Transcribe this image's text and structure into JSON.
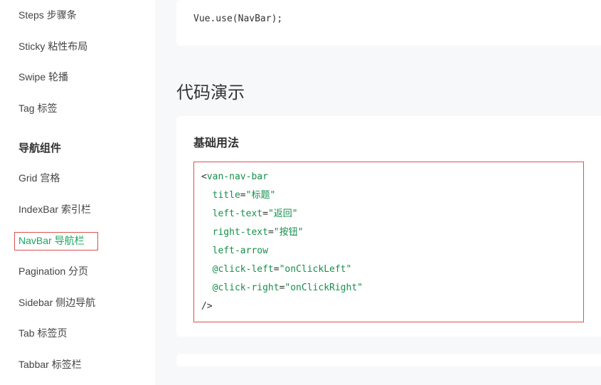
{
  "sidebar": {
    "group1": [
      {
        "label": "Steps 步骤条"
      },
      {
        "label": "Sticky 粘性布局"
      },
      {
        "label": "Swipe 轮播"
      },
      {
        "label": "Tag 标签"
      }
    ],
    "heading": "导航组件",
    "group2": [
      {
        "label": "Grid 宫格"
      },
      {
        "label": "IndexBar 索引栏"
      },
      {
        "label": "NavBar 导航栏",
        "active": true
      },
      {
        "label": "Pagination 分页"
      },
      {
        "label": "Sidebar 侧边导航"
      },
      {
        "label": "Tab 标签页"
      },
      {
        "label": "Tabbar 标签栏"
      }
    ]
  },
  "main": {
    "install_code": "Vue.use(NavBar);",
    "section_title": "代码演示",
    "sub_title": "基础用法",
    "code": {
      "tag": "van-nav-bar",
      "attrs": [
        {
          "name": "title",
          "value": "标题"
        },
        {
          "name": "left-text",
          "value": "返回"
        },
        {
          "name": "right-text",
          "value": "按钮"
        },
        {
          "name": "left-arrow",
          "value": null
        },
        {
          "name": "@click-left",
          "value": "onClickLeft"
        },
        {
          "name": "@click-right",
          "value": "onClickRight"
        }
      ]
    }
  }
}
